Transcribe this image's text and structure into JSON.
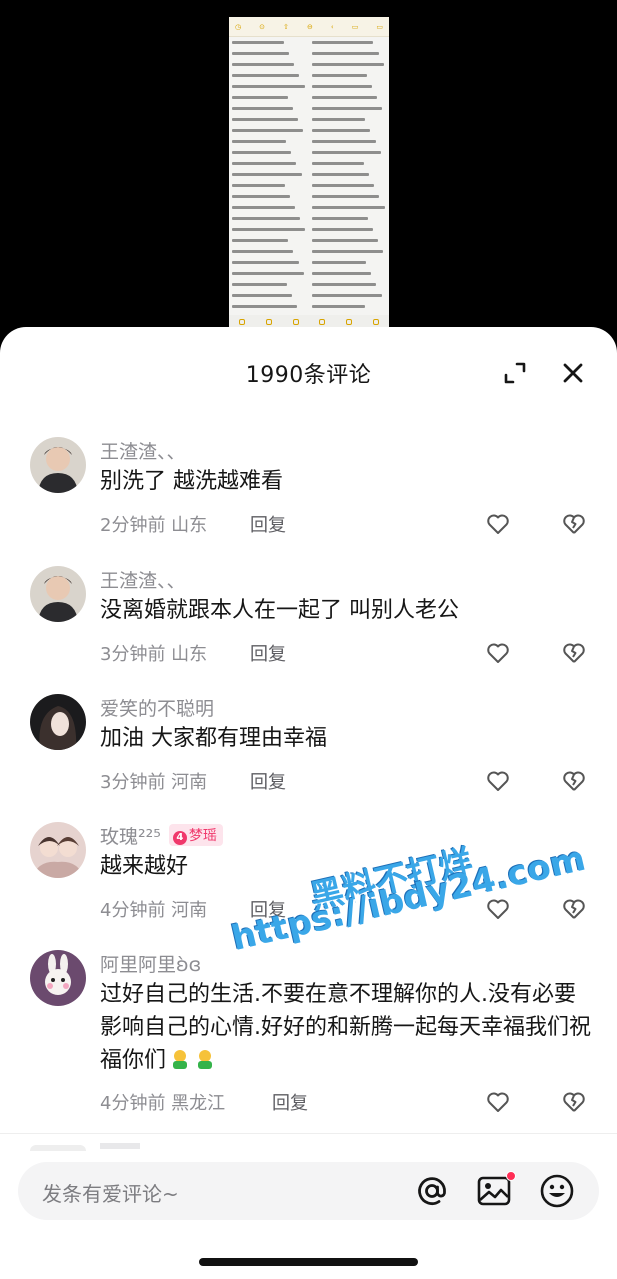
{
  "sheet": {
    "title": "1990条评论"
  },
  "comments": [
    {
      "user": "王渣渣、、",
      "text": "别洗了  越洗越难看",
      "meta": "2分钟前 山东",
      "reply": "回复"
    },
    {
      "user": "王渣渣、、",
      "text": "没离婚就跟本人在一起了 叫别人老公",
      "meta": "3分钟前 山东",
      "reply": "回复"
    },
    {
      "user": "爱笑的不聪明",
      "text": "加油 大家都有理由幸福",
      "meta": "3分钟前 河南",
      "reply": "回复"
    },
    {
      "user": "玫瑰²²⁵",
      "badge": "梦瑶",
      "badge_level": "4",
      "text": "越来越好",
      "meta": "4分钟前 河南",
      "reply": "回复"
    },
    {
      "user": "阿里阿里ʚ̀ɞ",
      "text": "过好自己的生活.不要在意不理解你的人.没有必要影响自己的心情.好好的和新腾一起每天幸福我们祝福你们",
      "meta": "4分钟前 黑龙江",
      "reply": "回复"
    }
  ],
  "watermark": {
    "line1": "黑料不打烊",
    "line2": "https://ibdy24.com"
  },
  "input": {
    "placeholder": "发条有爱评论~"
  },
  "colors": {
    "badge": "#f0386b",
    "watermark": "#3aa7e8",
    "notify_dot": "#ff2d55"
  }
}
